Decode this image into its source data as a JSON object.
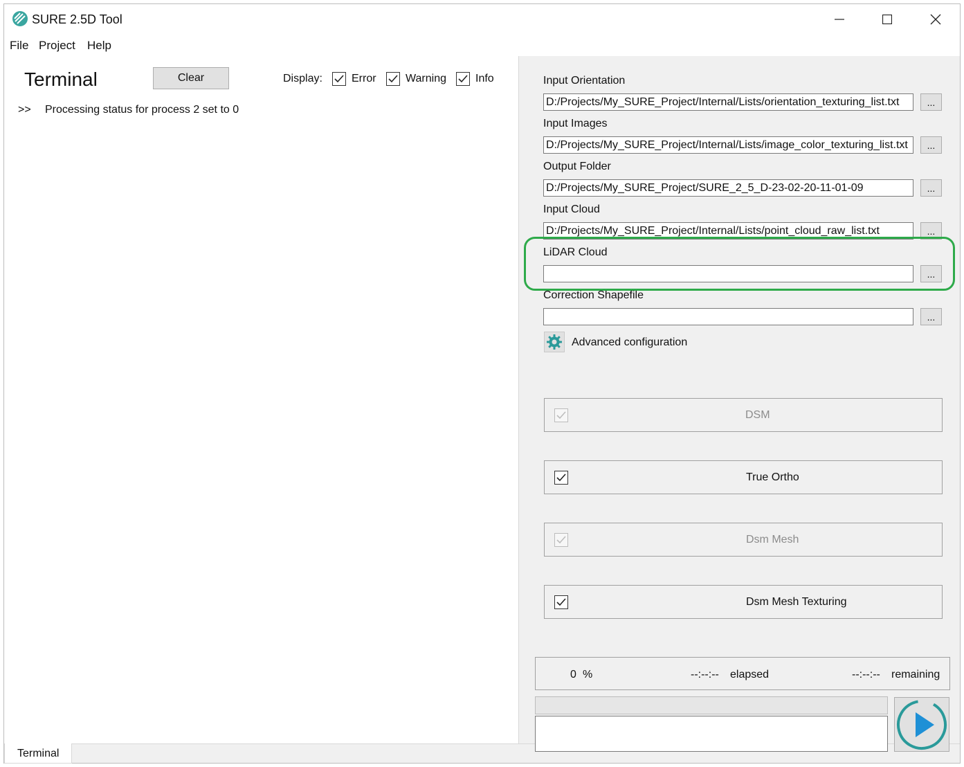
{
  "window": {
    "title": "SURE 2.5D Tool"
  },
  "menu": {
    "file": "File",
    "project": "Project",
    "help": "Help"
  },
  "terminal": {
    "title": "Terminal",
    "clear_label": "Clear",
    "display_label": "Display:",
    "filters": {
      "error": {
        "label": "Error",
        "checked": true
      },
      "warning": {
        "label": "Warning",
        "checked": true
      },
      "info": {
        "label": "Info",
        "checked": true
      }
    },
    "log": [
      {
        "prompt": ">>",
        "text": "Processing status for process 2 set to 0"
      }
    ],
    "tab_label": "Terminal"
  },
  "inputs": {
    "orientation": {
      "label": "Input Orientation",
      "value": "D:/Projects/My_SURE_Project/Internal/Lists/orientation_texturing_list.txt"
    },
    "images": {
      "label": "Input Images",
      "value": "D:/Projects/My_SURE_Project/Internal/Lists/image_color_texturing_list.txt"
    },
    "output": {
      "label": "Output Folder",
      "value": "D:/Projects/My_SURE_Project/SURE_2_5_D-23-02-20-11-01-09"
    },
    "cloud": {
      "label": "Input Cloud",
      "value": "D:/Projects/My_SURE_Project/Internal/Lists/point_cloud_raw_list.txt"
    },
    "lidar": {
      "label": "LiDAR Cloud",
      "value": ""
    },
    "shapefile": {
      "label": "Correction Shapefile",
      "value": ""
    },
    "browse_label": "..."
  },
  "advanced": {
    "label": "Advanced configuration",
    "icon": "gear-icon"
  },
  "steps": {
    "dsm": {
      "label": "DSM",
      "checked": true,
      "enabled": false
    },
    "true_ortho": {
      "label": "True Ortho",
      "checked": true,
      "enabled": true
    },
    "dsm_mesh": {
      "label": "Dsm Mesh",
      "checked": true,
      "enabled": false
    },
    "dsm_mesh_texturing": {
      "label": "Dsm Mesh Texturing",
      "checked": true,
      "enabled": true
    }
  },
  "status": {
    "percent": "0",
    "percent_unit": "%",
    "elapsed_time": "--:--:--",
    "elapsed_label": "elapsed",
    "remaining_time": "--:--:--",
    "remaining_label": "remaining",
    "progress": 0
  },
  "colors": {
    "highlight": "#2eaa4a",
    "run_button": "#1e90d6",
    "gear": "#2a9a9a"
  }
}
